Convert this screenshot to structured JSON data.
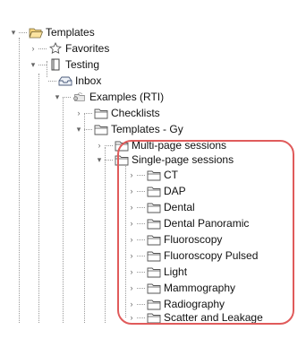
{
  "tree": {
    "templates": {
      "label": "Templates",
      "toggle": "▾",
      "icon": "folder-open-icon"
    },
    "favorites": {
      "label": "Favorites",
      "toggle": "›",
      "icon": "star-icon"
    },
    "testing": {
      "label": "Testing",
      "toggle": "▾",
      "icon": "notebook-icon"
    },
    "inbox": {
      "label": "Inbox",
      "icon": "inbox-icon"
    },
    "examples": {
      "label": "Examples (RTI)",
      "toggle": "▾",
      "icon": "shared-folder-icon"
    },
    "checklists": {
      "label": "Checklists",
      "toggle": "›",
      "icon": "folder-icon"
    },
    "templates_gy": {
      "label": "Templates - Gy",
      "toggle": "▾",
      "icon": "folder-icon"
    },
    "multi_page": {
      "label": "Multi-page sessions",
      "toggle": "›",
      "icon": "folder-icon"
    },
    "single_page": {
      "label": "Single-page sessions",
      "toggle": "▾",
      "icon": "folder-icon"
    },
    "single_page_children": [
      {
        "label": "CT",
        "toggle": "›"
      },
      {
        "label": "DAP",
        "toggle": "›"
      },
      {
        "label": "Dental",
        "toggle": "›"
      },
      {
        "label": "Dental Panoramic",
        "toggle": "›"
      },
      {
        "label": "Fluoroscopy",
        "toggle": "›"
      },
      {
        "label": "Fluoroscopy Pulsed",
        "toggle": "›"
      },
      {
        "label": "Light",
        "toggle": "›"
      },
      {
        "label": "Mammography",
        "toggle": "›"
      },
      {
        "label": "Radiography",
        "toggle": "›"
      },
      {
        "label": "Scatter and Leakage",
        "toggle": "›"
      }
    ]
  },
  "colors": {
    "highlight": "#e05b5b",
    "folder": "#f4d27a",
    "folder_stroke": "#7a6a3a"
  }
}
